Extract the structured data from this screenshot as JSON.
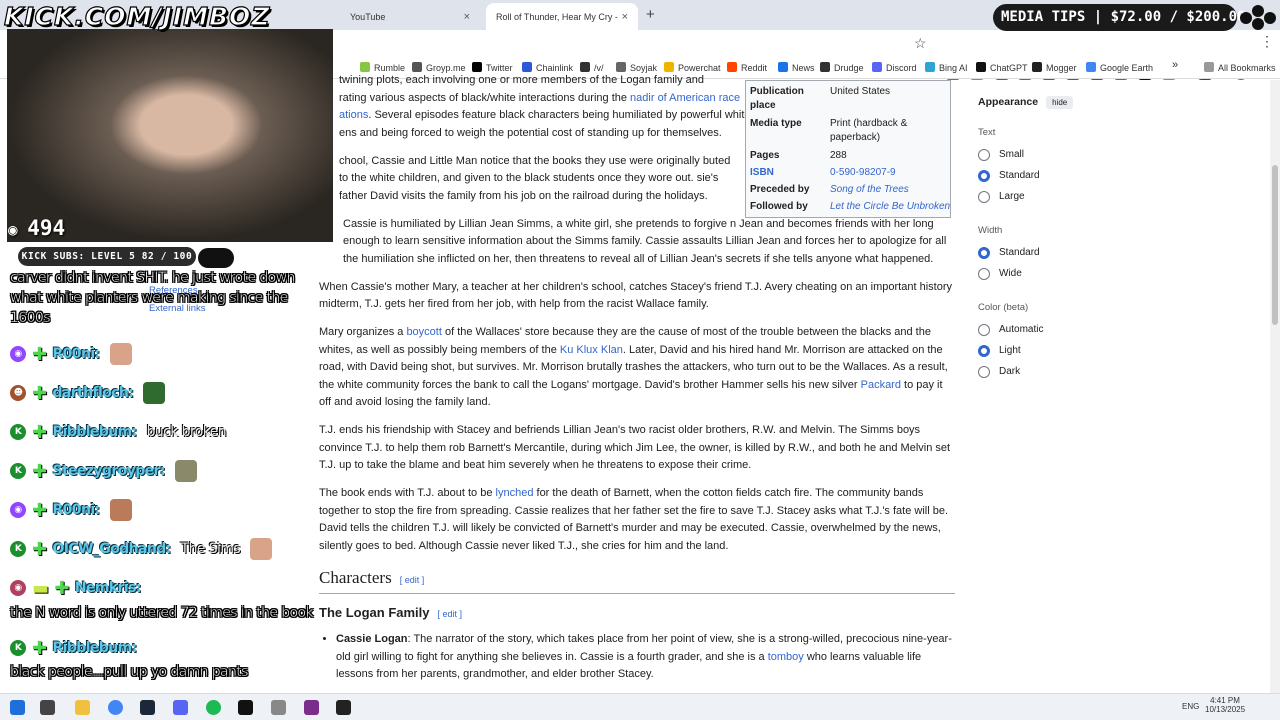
{
  "browser": {
    "tabs": [
      {
        "label": "YouTube",
        "active": false
      },
      {
        "label": "Roll of Thunder, Hear My Cry -",
        "active": true
      }
    ],
    "new_tab": "+",
    "close": "×",
    "bookmarks": [
      {
        "label": "Rumble",
        "color": "#85c742"
      },
      {
        "label": "Groyp.me",
        "color": "#555555"
      },
      {
        "label": "Twitter",
        "color": "#000000"
      },
      {
        "label": "Chainlink",
        "color": "#2a5ada"
      },
      {
        "label": "/v/",
        "color": "#333333"
      },
      {
        "label": "Soyjak",
        "color": "#666666"
      },
      {
        "label": "Powerchat",
        "color": "#f0b400"
      },
      {
        "label": "Reddit",
        "color": "#ff4500"
      },
      {
        "label": "News",
        "color": "#1a73e8"
      },
      {
        "label": "Drudge",
        "color": "#333333"
      },
      {
        "label": "Discord",
        "color": "#5865f2"
      },
      {
        "label": "Bing AI",
        "color": "#2ea4d6"
      },
      {
        "label": "ChatGPT",
        "color": "#111111"
      },
      {
        "label": "Mogger",
        "color": "#222222"
      },
      {
        "label": "Google Earth",
        "color": "#4285f4"
      }
    ],
    "all_bookmarks": "All Bookmarks",
    "overflow": "»"
  },
  "article": {
    "p0": {
      "t1": "twining plots, each involving one or more members of the Logan family and",
      "t2": "rating various aspects of black/white interactions during the ",
      "l1": "nadir of American race",
      "l2": "ations",
      "t3": ". Several episodes feature black characters being humiliated by powerful white",
      "t4": "ens and being forced to weigh the potential cost of standing up for themselves."
    },
    "p1": "chool, Cassie and Little Man notice that the books they use were originally buted to the white children, and given to the black students once they wore out. sie's father David visits the family from his job on the railroad during the holidays.",
    "p2": {
      "l1": "",
      "t1": "Cassie is humiliated by Lillian Jean Simms, a white girl, she pretends to forgive n Jean and becomes friends with her long enough to learn sensitive information about the Simms family. Cassie assaults Lillian Jean and forces her to apologize for all the humiliation she inflicted on her, then threatens to reveal all of Lillian Jean's secrets if she tells anyone what happened."
    },
    "p3": "When Cassie's mother Mary, a teacher at her children's school, catches Stacey's friend T.J. Avery cheating on an important history midterm, T.J. gets her fired from her job, with help from the racist Wallace family.",
    "p4": {
      "t1": "Mary organizes a ",
      "l1": "boycott",
      "t2": " of the Wallaces' store because they are the cause of most of the trouble between the blacks and the whites, as well as possibly being members of the ",
      "l2": "Ku Klux Klan",
      "t3": ". Later, David and his hired hand Mr. Morrison are attacked on the road, with David being shot, but survives. Mr. Morrison brutally trashes the attackers, who turn out to be the Wallaces. As a result, the white community forces the bank to call the Logans' mortgage. David's brother Hammer sells his new silver ",
      "l3": "Packard",
      "t4": " to pay it off and avoid losing the family land."
    },
    "p5": "T.J. ends his friendship with Stacey and befriends Lillian Jean's two racist older brothers, R.W. and Melvin. The Simms boys convince T.J. to help them rob Barnett's Mercantile, during which Jim Lee, the owner, is killed by R.W., and both he and Melvin set T.J. up to take the blame and beat him severely when he threatens to expose their crime.",
    "p6": {
      "t1": "The book ends with T.J. about to be ",
      "l1": "lynched",
      "t2": " for the death of Barnett, when the cotton fields catch fire. The community bands together to stop the fire from spreading. Cassie realizes that her father set the fire to save T.J. Stacey asks what T.J.'s fate will be. David tells the children T.J. will likely be convicted of Barnett's murder and may be executed. Cassie, overwhelmed by the news, silently goes to bed. Although Cassie never liked T.J., she cries for him and the land."
    },
    "characters_heading": "Characters",
    "edit_label": "[ edit ]",
    "family_heading": "The Logan Family",
    "li1": {
      "name": "Cassie Logan",
      "t1": ": The narrator of the story, which takes place from her point of view, she is a strong-willed, precocious nine-year-old girl willing to fight for anything she believes in. Cassie is a fourth grader, and she is a ",
      "l1": "tomboy",
      "t2": " who learns valuable life lessons from her parents, grandmother, and elder brother Stacey."
    }
  },
  "infobox": {
    "rows": [
      {
        "label": "Publication place",
        "value": "United States"
      },
      {
        "label": "Media type",
        "value": "Print (hardback & paperback)"
      },
      {
        "label": "Pages",
        "value": "288"
      },
      {
        "label": "ISBN",
        "value": "0-590-98207-9"
      },
      {
        "label": "Preceded by",
        "value": "Song of the Trees"
      },
      {
        "label": "Followed by",
        "value": "Let the Circle Be Unbroken"
      }
    ]
  },
  "appearance": {
    "title": "Appearance",
    "hide": "hide",
    "text_label": "Text",
    "text_options": [
      "Small",
      "Standard",
      "Large"
    ],
    "text_selected": "Standard",
    "width_label": "Width",
    "width_options": [
      "Standard",
      "Wide"
    ],
    "width_selected": "Standard",
    "color_label": "Color (beta)",
    "color_options": [
      "Automatic",
      "Light",
      "Dark"
    ],
    "color_selected": "Light"
  },
  "stream": {
    "logo": "KICK.COM/JIMBOZ",
    "viewers": "494",
    "subs": "KICK SUBS: LEVEL 5 82 / 100",
    "media_tips": "MEDIA TIPS | $72.00 / $200.00",
    "refs": [
      "References",
      "External links"
    ],
    "chat_top": "carver didnt invent SHIT. he just wrote down what white planters were making since the 1600s",
    "chat": [
      {
        "badge": "◉",
        "badge_color": "#9146ff",
        "user": "R00ni:",
        "msg": "",
        "emote": "#d9a38a"
      },
      {
        "badge": "☻",
        "badge_color": "#a0522d",
        "user": "darthfloch:",
        "msg": "",
        "emote": "#2f6b2f"
      },
      {
        "badge": "K",
        "badge_color": "#1b8f2e",
        "user": "Ribblebum:",
        "msg": "buck broken",
        "emote": ""
      },
      {
        "badge": "K",
        "badge_color": "#1b8f2e",
        "user": "Steezygroyper:",
        "msg": "",
        "emote": "#8a8a6a"
      },
      {
        "badge": "◉",
        "badge_color": "#9146ff",
        "user": "R00ni:",
        "msg": "",
        "emote": "#b97b5a"
      },
      {
        "badge": "K",
        "badge_color": "#1b8f2e",
        "user": "OICW_Godhand:",
        "msg": "The Sims",
        "emote": "#d9a38a"
      },
      {
        "badge": "◉",
        "badge_color": "#b04060",
        "user": "Nemkris:",
        "msg": "",
        "emote": ""
      }
    ],
    "chat_msg2": "the N word is only uttered 72 times in the book",
    "chat_last_user": "Ribblebum:",
    "chat_last_msg": "black people...pull up yo damn pants"
  },
  "taskbar": {
    "lang": "ENG",
    "time": "4:41 PM",
    "date": "10/13/2025"
  }
}
